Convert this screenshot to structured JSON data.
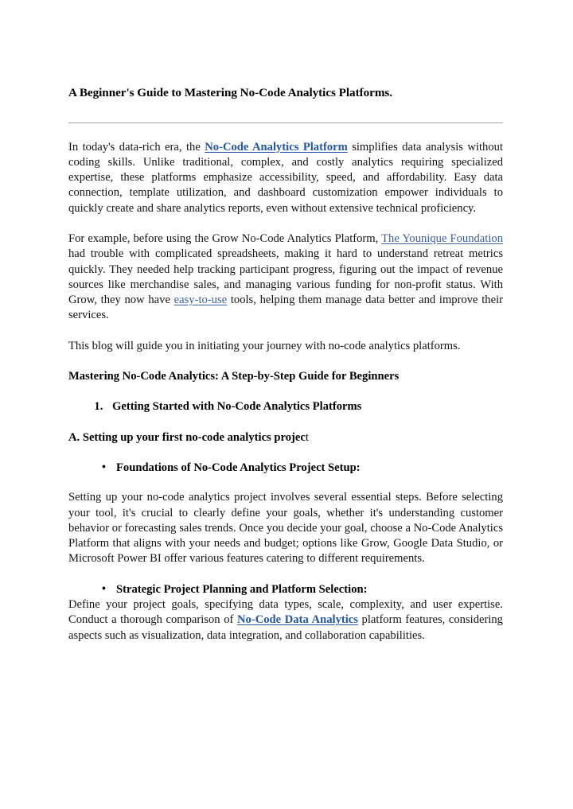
{
  "document": {
    "title": "A Beginner's Guide to Mastering No-Code Analytics Platforms.",
    "colors": {
      "link_blue": "#2255a4",
      "link_soft_blue": "#3a5f9e",
      "text": "#131313",
      "divider": "#a8a8a8"
    },
    "intro": {
      "p1_part1": "In today's data-rich era, the ",
      "p1_link": "No-Code Analytics Platform",
      "p1_part2": " simplifies data analysis without coding skills. Unlike traditional, complex, and costly analytics requiring specialized expertise, these platforms emphasize accessibility, speed, and affordability. Easy data connection, template utilization, and dashboard customization empower individuals to quickly create and share analytics reports, even without extensive technical proficiency.",
      "p2_part1": "For example, before using the Grow No-Code Analytics Platform, ",
      "p2_link1": "The Younique Foundation ",
      "p2_part2": "had trouble with complicated spreadsheets, making it hard to understand retreat metrics quickly. They needed help tracking participant progress, figuring out the impact of revenue sources like merchandise sales, and managing various funding for non-profit status. With Grow, they now have ",
      "p2_link2": "easy-to-use",
      "p2_part3": " tools, helping them manage data better and improve their services.",
      "p3": "This blog will guide you in initiating your journey with no-code analytics platforms."
    },
    "sections": {
      "main_heading": "Mastering No-Code Analytics: A Step-by-Step Guide for Beginners",
      "numbered_item_1": "Getting Started with No-Code Analytics Platforms",
      "alpha_heading_a_bold": "A. Setting up your first no-code analytics projec",
      "alpha_heading_a_tail": "t",
      "bullet_1": "Foundations of No-Code Analytics Project Setup:",
      "bullet_1_body": "Setting up your no-code analytics project involves several essential steps. Before selecting your tool, it's crucial to clearly define your goals, whether it's understanding customer behavior or forecasting sales trends. Once you decide your goal, choose a No-Code Analytics Platform that aligns with your needs and budget; options like Grow, Google Data Studio, or Microsoft Power BI offer various features catering to different requirements.",
      "bullet_2": "Strategic Project Planning and Platform Selection:",
      "bullet_2_body_part1": "Define your project goals, specifying data types, scale, complexity, and user expertise. Conduct a thorough comparison of ",
      "bullet_2_link": "No-Code Data Analytics",
      "bullet_2_body_part2": " platform features, considering aspects such as visualization, data integration, and collaboration capabilities."
    }
  }
}
